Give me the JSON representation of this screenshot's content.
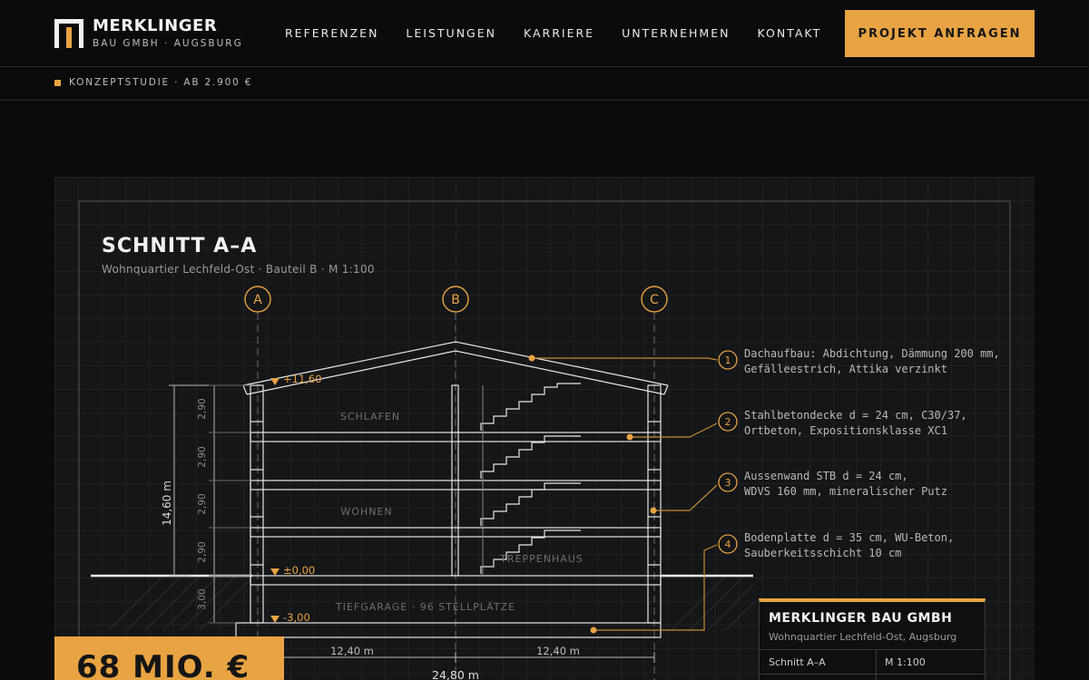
{
  "header": {
    "brand_name": "MERKLINGER",
    "brand_sub": "BAU GMBH · AUGSBURG",
    "nav": [
      "REFERENZEN",
      "LEISTUNGEN",
      "KARRIERE",
      "UNTERNEHMEN",
      "KONTAKT"
    ],
    "cta_label": "PROJEKT ANFRAGEN"
  },
  "subbar": {
    "text": "KONZEPTSTUDIE · AB 2.900 €"
  },
  "drawing": {
    "title": "SCHNITT A–A",
    "subtitle": "Wohnquartier Lechfeld-Ost · Bauteil B · M 1:100",
    "axes": [
      "A",
      "B",
      "C"
    ],
    "levels": [
      "+11,60",
      "±0,00",
      "-3,00"
    ],
    "floor_heights": [
      "2,90",
      "2,90",
      "2,90",
      "2,90",
      "3,00"
    ],
    "total_height": "14,60 m",
    "rooms": [
      "SCHLAFEN",
      "WOHNEN",
      "TREPPENHAUS",
      "TIEFGARAGE · 96 STELLPLÄTZE"
    ],
    "spans": [
      "12,40 m",
      "12,40 m"
    ],
    "total_width": "24,80 m",
    "callouts": [
      {
        "num": "1",
        "line1": "Dachaufbau: Abdichtung, Dämmung 200 mm,",
        "line2": "Gefälleestrich, Attika verzinkt"
      },
      {
        "num": "2",
        "line1": "Stahlbetondecke d = 24 cm, C30/37,",
        "line2": "Ortbeton, Expositionsklasse XC1"
      },
      {
        "num": "3",
        "line1": "Aussenwand STB d = 24 cm,",
        "line2": "WDVS 160 mm, mineralischer Putz"
      },
      {
        "num": "4",
        "line1": "Bodenplatte d = 35 cm, WU-Beton,",
        "line2": "Sauberkeitsschicht 10 cm"
      }
    ]
  },
  "stamp": {
    "title": "MERKLINGER BAU GMBH",
    "sub": "Wohnquartier Lechfeld-Ost, Augsburg",
    "label": "Schnitt A–A",
    "scale": "M 1:100"
  },
  "badge": {
    "text": "68 MIO. €"
  },
  "colors": {
    "accent": "#e8a342",
    "background": "#0b0b0c",
    "panel": "#151618"
  }
}
